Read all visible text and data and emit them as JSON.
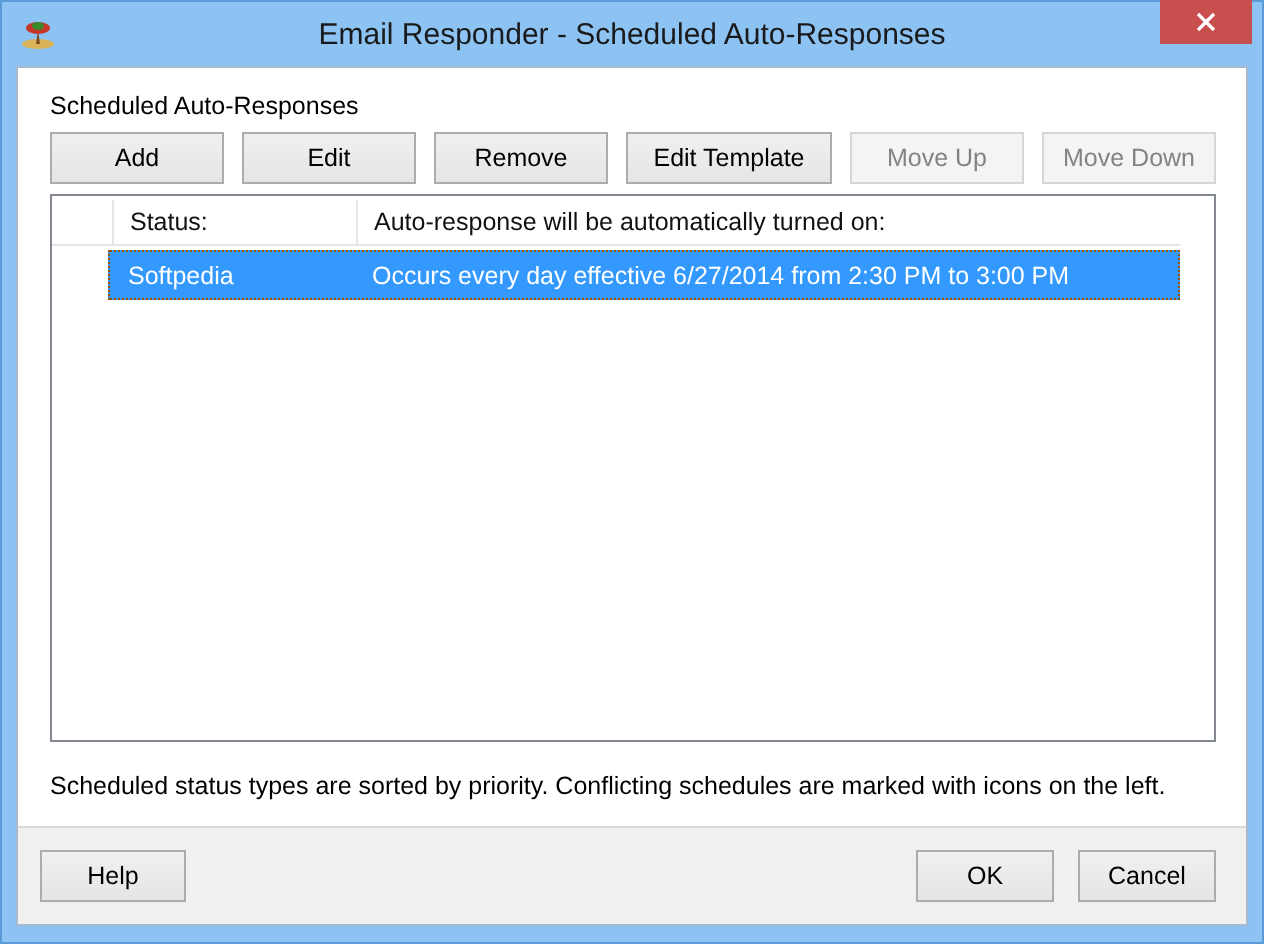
{
  "window": {
    "title": "Email Responder - Scheduled Auto-Responses"
  },
  "group_label": "Scheduled Auto-Responses",
  "toolbar": [
    {
      "label": "Add",
      "disabled": false
    },
    {
      "label": "Edit",
      "disabled": false
    },
    {
      "label": "Remove",
      "disabled": false
    },
    {
      "label": "Edit Template",
      "disabled": false
    },
    {
      "label": "Move Up",
      "disabled": true
    },
    {
      "label": "Move Down",
      "disabled": true
    }
  ],
  "table": {
    "columns": [
      "Status:",
      "Auto-response will be automatically turned on:"
    ],
    "rows": [
      {
        "status": "Softpedia",
        "schedule": "Occurs every day effective 6/27/2014 from 2:30 PM to 3:00 PM",
        "selected": true
      }
    ]
  },
  "note": "Scheduled status types are sorted by priority. Conflicting schedules are marked with icons on the left.",
  "footer": {
    "left": [
      "Help"
    ],
    "right": [
      "OK",
      "Cancel"
    ]
  }
}
